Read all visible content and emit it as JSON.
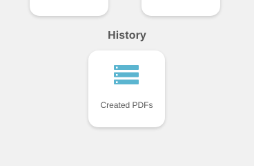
{
  "section": {
    "title": "History"
  },
  "history_card": {
    "label": "Created PDFs",
    "icon": "stacked-list-icon"
  },
  "colors": {
    "background": "#f1f1f1",
    "card": "#ffffff",
    "title_text": "#555555",
    "label_text": "#595959",
    "icon_accent": "#5bb5d0"
  }
}
